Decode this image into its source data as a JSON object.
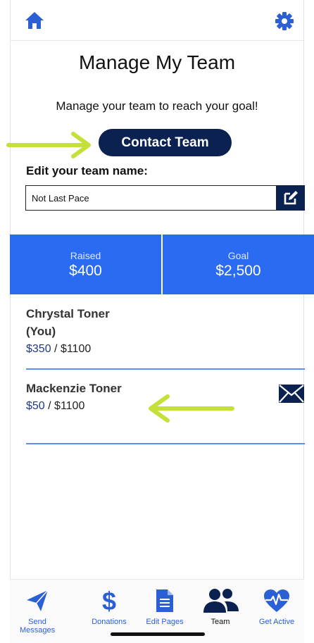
{
  "header": {
    "home_icon": "home-icon",
    "settings_icon": "gear-icon"
  },
  "main": {
    "title": "Manage My Team",
    "subtitle": "Manage your team to reach your goal!",
    "contact_button": "Contact Team",
    "edit_label": "Edit your team name:",
    "team_name_value": "Not Last Pace"
  },
  "stats": {
    "raised_label": "Raised",
    "raised_value": "$400",
    "goal_label": "Goal",
    "goal_value": "$2,500"
  },
  "members": [
    {
      "name": "Chrystal Toner (You)",
      "raised": "$350",
      "separator": " / ",
      "goal": "$1100",
      "has_mail": false
    },
    {
      "name": "Mackenzie Toner",
      "raised": "$50",
      "separator": " / ",
      "goal": "$1100",
      "has_mail": true
    }
  ],
  "bottom_nav": [
    {
      "label": "Send Messages",
      "icon": "paper-plane-icon"
    },
    {
      "label": "Donations",
      "icon": "dollar-icon"
    },
    {
      "label": "Edit Pages",
      "icon": "document-icon"
    },
    {
      "label": "Team",
      "icon": "team-icon",
      "active": true
    },
    {
      "label": "Get Active",
      "icon": "heart-pulse-icon"
    }
  ],
  "colors": {
    "navy": "#0b2150",
    "blue": "#2a6bf2",
    "arrow": "#c6e03a"
  }
}
